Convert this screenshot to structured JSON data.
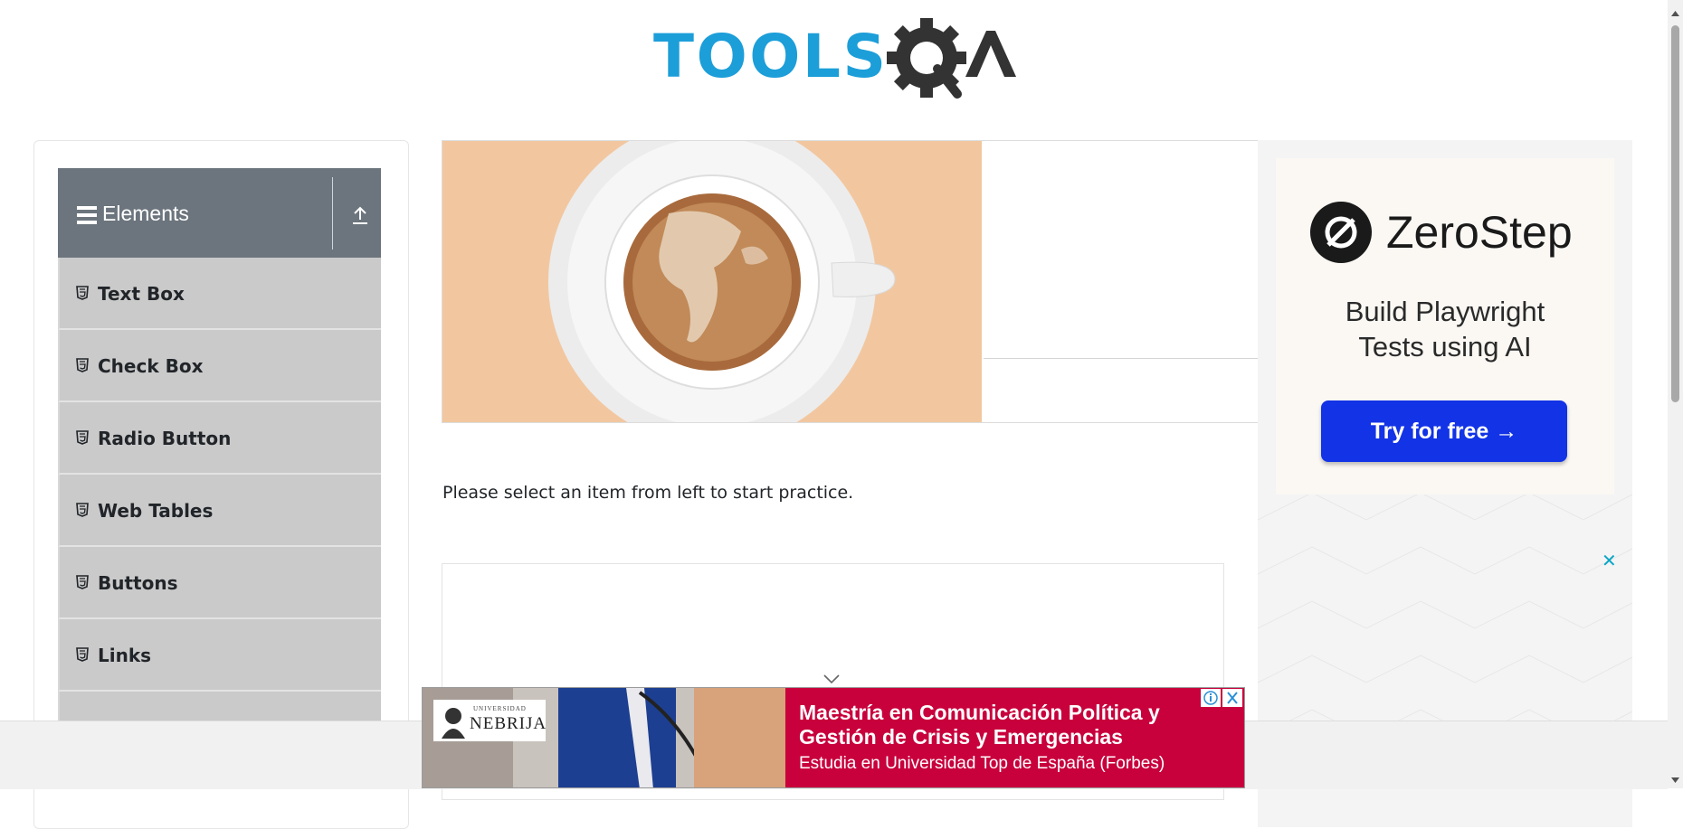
{
  "header": {
    "logo_text": "TOOLSQA"
  },
  "sidebar": {
    "group_title": "Elements",
    "items": [
      {
        "label": "Text Box"
      },
      {
        "label": "Check Box"
      },
      {
        "label": "Radio Button"
      },
      {
        "label": "Web Tables"
      },
      {
        "label": "Buttons"
      },
      {
        "label": "Links"
      },
      {
        "label": ""
      }
    ]
  },
  "main": {
    "instruction": "Please select an item from left to start practice."
  },
  "ad_right": {
    "brand": "ZeroStep",
    "tagline_line1": "Build Playwright",
    "tagline_line2": "Tests using AI",
    "cta": "Try for free →"
  },
  "ad_bottom": {
    "logo_small": "UNIVERSIDAD",
    "logo_name": "NEBRIJA",
    "title_line1": "Maestría en Comunicación Política y",
    "title_line2": "Gestión de Crisis y Emergencias",
    "subtitle": "Estudia en Universidad Top de España (Forbes)"
  },
  "colors": {
    "sidebar_header": "#6c757d",
    "menu_item_bg": "#cacaca",
    "logo_blue": "#1c9ed9",
    "logo_dark": "#333333",
    "cta_blue": "#1233e6",
    "bottom_ad_red": "#c8003c"
  }
}
